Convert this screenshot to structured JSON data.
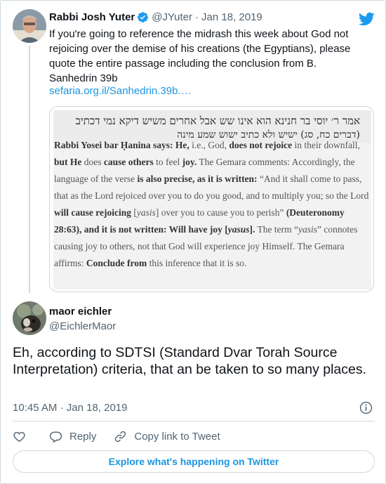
{
  "parent_tweet": {
    "author_name": "Rabbi Josh Yuter",
    "handle": "@JYuter",
    "separator": "·",
    "date": "Jan 18, 2019",
    "text": "If you're going to reference the midrash this week about God not rejoicing over the demise of his creations (the Egyptians), please quote the entire passage including the conclusion from B. Sanhedrin 39b",
    "link": "sefaria.org.il/Sanhedrin.39b.…",
    "image": {
      "hebrew_line1": "אמר ר׳ יוסי בר חנינא הוא אינו שש אבל אחרים משיש דיקא נמי דכתיב",
      "hebrew_line2": "(דברים כח, סג) ישיש ולא כתיב ישוש שמע מינה"
    }
  },
  "main_tweet": {
    "author_name": "maor eichler",
    "handle": "@EichlerMaor",
    "text": "Eh, according to SDTSI (Standard Dvar Torah Source Interpretation) criteria, that an be taken to so many places.",
    "time": "10:45 AM",
    "separator": "·",
    "date": "Jan 18, 2019"
  },
  "actions": {
    "reply_label": "Reply",
    "copy_link_label": "Copy link to Tweet"
  },
  "explore_label": "Explore what's happening on Twitter",
  "colors": {
    "link_blue": "#1b95e0",
    "verified_blue": "#1d9bf0",
    "muted_gray": "#536471",
    "border": "#cfd9de"
  },
  "icons": [
    "verified-badge-icon",
    "twitter-bird-icon",
    "info-icon",
    "heart-icon",
    "reply-icon",
    "copy-link-icon"
  ]
}
